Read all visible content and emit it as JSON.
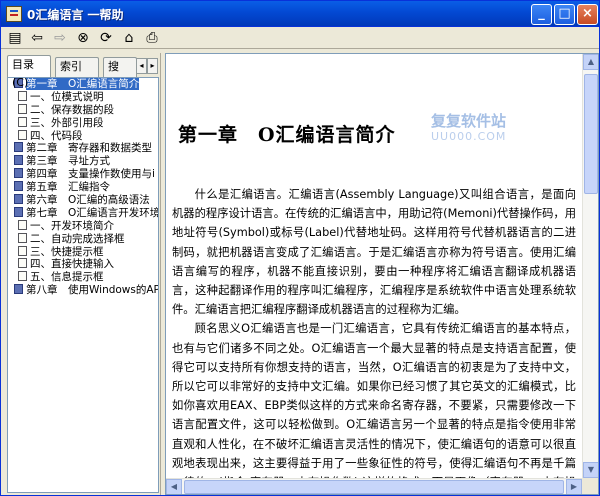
{
  "window": {
    "title": "0汇编语言 一帮助"
  },
  "titlebar_buttons": {
    "minimize": "_",
    "maximize": "□",
    "close": "×"
  },
  "tabs": [
    {
      "label": "目录(C)"
    },
    {
      "label": "索引(N)"
    },
    {
      "label": "搜"
    }
  ],
  "tab_scroll": {
    "left": "◂",
    "right": "▸"
  },
  "tree": [
    {
      "label": "第一章　O汇编语言简介",
      "level": 1,
      "type": "book",
      "selected": true
    },
    {
      "label": "一、位模式说明",
      "level": 2,
      "type": "page"
    },
    {
      "label": "二、保存数据的段",
      "level": 2,
      "type": "page"
    },
    {
      "label": "三、外部引用段",
      "level": 2,
      "type": "page"
    },
    {
      "label": "四、代码段",
      "level": 2,
      "type": "page"
    },
    {
      "label": "第二章　寄存器和数据类型",
      "level": 1,
      "type": "book"
    },
    {
      "label": "第三章　寻址方式",
      "level": 1,
      "type": "book"
    },
    {
      "label": "第四章　支量操作数使用与i",
      "level": 1,
      "type": "book"
    },
    {
      "label": "第五章　汇编指令",
      "level": 1,
      "type": "book"
    },
    {
      "label": "第六章　O汇编的高级语法",
      "level": 1,
      "type": "book"
    },
    {
      "label": "第七章　O汇编语言开发环境",
      "level": 1,
      "type": "book"
    },
    {
      "label": "一、开发环境简介",
      "level": 2,
      "type": "page"
    },
    {
      "label": "二、自动完成选择框",
      "level": 2,
      "type": "page"
    },
    {
      "label": "三、快捷提示框",
      "level": 2,
      "type": "page"
    },
    {
      "label": "四、直接快捷输入",
      "level": 2,
      "type": "page"
    },
    {
      "label": "五、信息提示框",
      "level": 2,
      "type": "page"
    },
    {
      "label": "第八章　使用Windows的API",
      "level": 1,
      "type": "book"
    }
  ],
  "content": {
    "heading": "第一章　O汇编语言简介",
    "watermark": "复复软件站",
    "watermark2": "UU000.COM",
    "para1": "什么是汇编语言。汇编语言(Assembly Language)又叫组合语言，是面向机器的程序设计语言。在传统的汇编语言中，用助记符(Memoni)代替操作码，用地址符号(Symbol)或标号(Label)代替地址码。这样用符号代替机器语言的二进制码，就把机器语言变成了汇编语言。于是汇编语言亦称为符号语言。使用汇编语言编写的程序，机器不能直接识别，要由一种程序将汇编语言翻译成机器语言，这种起翻译作用的程序叫汇编程序，汇编程序是系统软件中语言处理系统软件。汇编语言把汇编程序翻译成机器语言的过程称为汇编。",
    "para2": "顾名思义O汇编语言也是一门汇编语言，它具有传统汇编语言的基本特点，也有与它们诸多不同之处。O汇编语言一个最大显著的特点是支持语言配置，使得它可以支持所有你想支持的语言，当然，O汇编语言的初衷是为了支持中文，所以它可以非常好的支持中文汇编。如果你已经习惯了其它英文的汇编模式，比如你喜欢用EAX、EBP类似这样的方式来命名寄存器，不要紧，只需要修改一下语言配置文件，这可以轻松做到。O汇编语言另一个显著的特点是指令使用非常直观和人性化，在不破坏汇编语言灵活性的情况下，使汇编语句的语意可以很直观地表现出来，这主要得益于用了一些象征性的符号，使得汇编语句不再是千篇一律的　(指令 寄存器，内存操作数) 这样的格式，而是更像（寄存器 = 内存操作数这样的格式，不但容易理解，而且便于记忆。使"
  },
  "colors": {
    "titlebar": "#0a5ee6",
    "selection": "#316ac5"
  }
}
